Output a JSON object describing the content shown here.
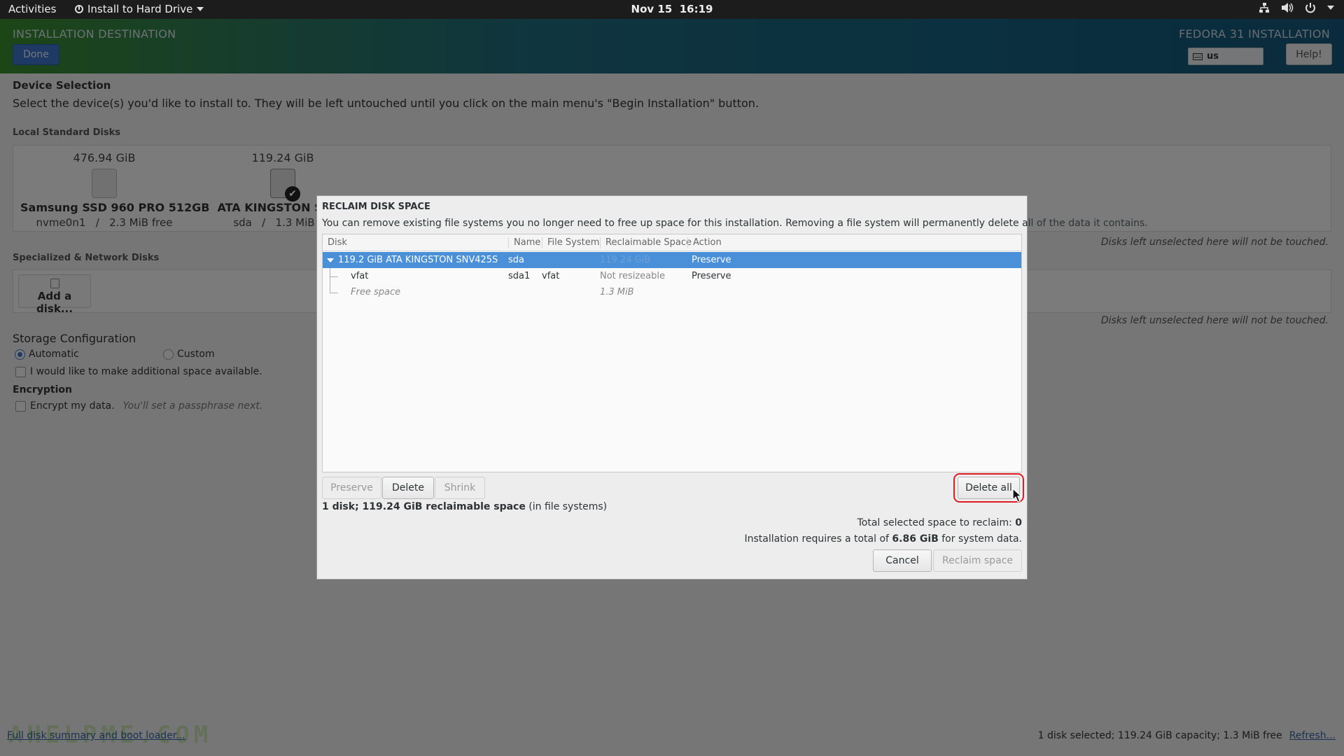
{
  "topbar": {
    "activities": "Activities",
    "app_menu": "Install to Hard Drive",
    "clock_date": "Nov 15",
    "clock_time": "16:19"
  },
  "header": {
    "title": "INSTALLATION DESTINATION",
    "done": "Done",
    "product": "FEDORA 31 INSTALLATION",
    "keyboard_layout": "us",
    "help": "Help!"
  },
  "background": {
    "device_selection": "Device Selection",
    "device_desc": "Select the device(s) you'd like to install to.  They will be left untouched until you click on the main menu's \"Begin Installation\" button.",
    "local_disks": "Local Standard Disks",
    "disks": [
      {
        "size": "476.94 GiB",
        "name": "Samsung SSD 960 PRO 512GB",
        "dev": "nvme0n1",
        "sep": "/",
        "free": "2.3 MiB free"
      },
      {
        "size": "119.24 GiB",
        "name": "ATA KINGSTON SNV4",
        "dev": "sda",
        "sep": "/",
        "free": "1.3 MiB fre"
      }
    ],
    "untouched_note": "Disks left unselected here will not be touched.",
    "specialized": "Specialized & Network Disks",
    "add_disk": "Add a disk...",
    "untouched_note2": "Disks left unselected here will not be touched.",
    "storage_config": "Storage Configuration",
    "automatic": "Automatic",
    "custom": "Custom",
    "additional_space": "I would like to make additional space available.",
    "encryption": "Encryption",
    "encrypt": "Encrypt my data.",
    "passphrase_hint": "You'll set a passphrase next.",
    "full_summary": "Full disk summary and boot loader...",
    "status": "1 disk selected; 119.24 GiB capacity; 1.3 MiB free",
    "refresh": "Refresh...",
    "watermark": "AHELPME.COM"
  },
  "dialog": {
    "title": "RECLAIM DISK SPACE",
    "description": "You can remove existing file systems you no longer need to free up space for this installation.  Removing a file system will permanently delete all of the data it contains.",
    "columns": [
      "Disk",
      "Name",
      "File System",
      "Reclaimable Space",
      "Action"
    ],
    "rows": [
      {
        "disk": "119.2 GiB ATA KINGSTON SNV425S",
        "name": "sda",
        "fs": "",
        "reclaim": "119.24 GiB",
        "action": "Preserve"
      },
      {
        "disk": "vfat",
        "name": "sda1",
        "fs": "vfat",
        "reclaim": "Not resizeable",
        "action": "Preserve"
      },
      {
        "disk": "Free space",
        "name": "",
        "fs": "",
        "reclaim": "1.3 MiB",
        "action": ""
      }
    ],
    "btn_preserve": "Preserve",
    "btn_delete": "Delete",
    "btn_shrink": "Shrink",
    "btn_delete_all": "Delete all",
    "summary_bold": "1 disk; 119.24 GiB reclaimable space",
    "summary_rest": " (in file systems)",
    "total_label": "Total selected space to reclaim: ",
    "total_value": "0",
    "requires_pre": "Installation requires a total of ",
    "requires_value": "6.86 GiB",
    "requires_post": " for system data.",
    "btn_cancel": "Cancel",
    "btn_reclaim": "Reclaim space"
  },
  "colors": {
    "selection": "#4a90d9",
    "accent": "#3c75c8",
    "highlight_ring": "#e01b24"
  }
}
